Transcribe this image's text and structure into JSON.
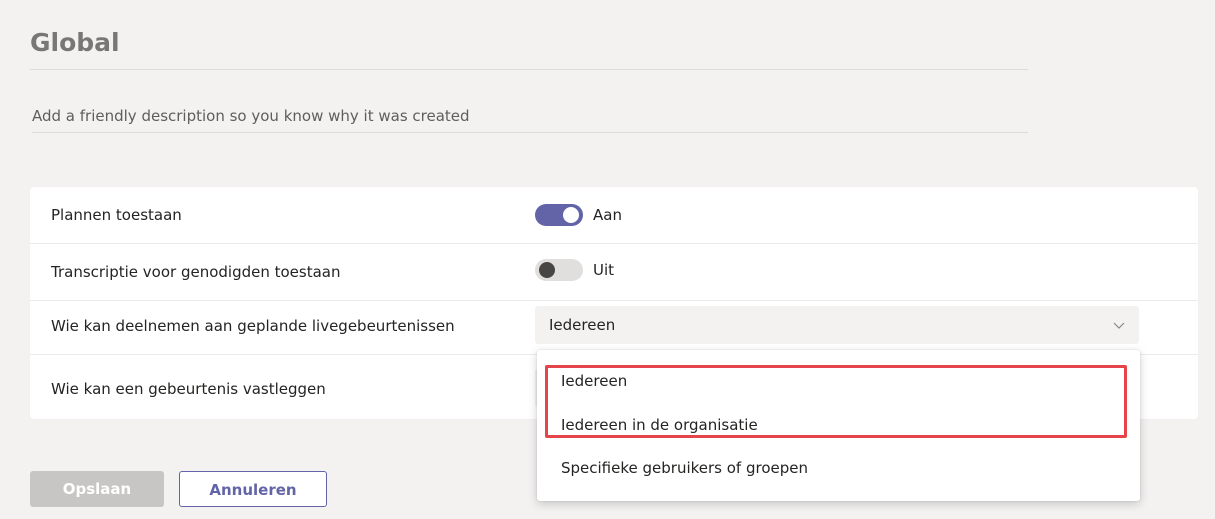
{
  "header": {
    "title": "Global"
  },
  "description": {
    "text": "Add a friendly description so you know why it was created"
  },
  "settings": {
    "rows": [
      {
        "label": "Plannen toestaan",
        "control": "toggle",
        "state": "on",
        "state_label": "Aan"
      },
      {
        "label": "Transcriptie voor genodigden toestaan",
        "control": "toggle",
        "state": "off",
        "state_label": "Uit"
      },
      {
        "label": "Wie kan deelnemen aan geplande livegebeurtenissen",
        "control": "select",
        "value": "Iedereen"
      },
      {
        "label": "Wie kan een gebeurtenis vastleggen",
        "control": "select",
        "value": ""
      }
    ]
  },
  "dropdown": {
    "options": [
      {
        "label": "Iedereen"
      },
      {
        "label": "Iedereen in de organisatie"
      },
      {
        "label": "Specifieke gebruikers of groepen"
      }
    ]
  },
  "actions": {
    "save_label": "Opslaan",
    "cancel_label": "Annuleren"
  },
  "colors": {
    "accent": "#6264a7",
    "highlight": "#e4444a",
    "disabled": "#c8c6c4"
  },
  "icons": {
    "select_chevron": "chevron-down-icon"
  }
}
